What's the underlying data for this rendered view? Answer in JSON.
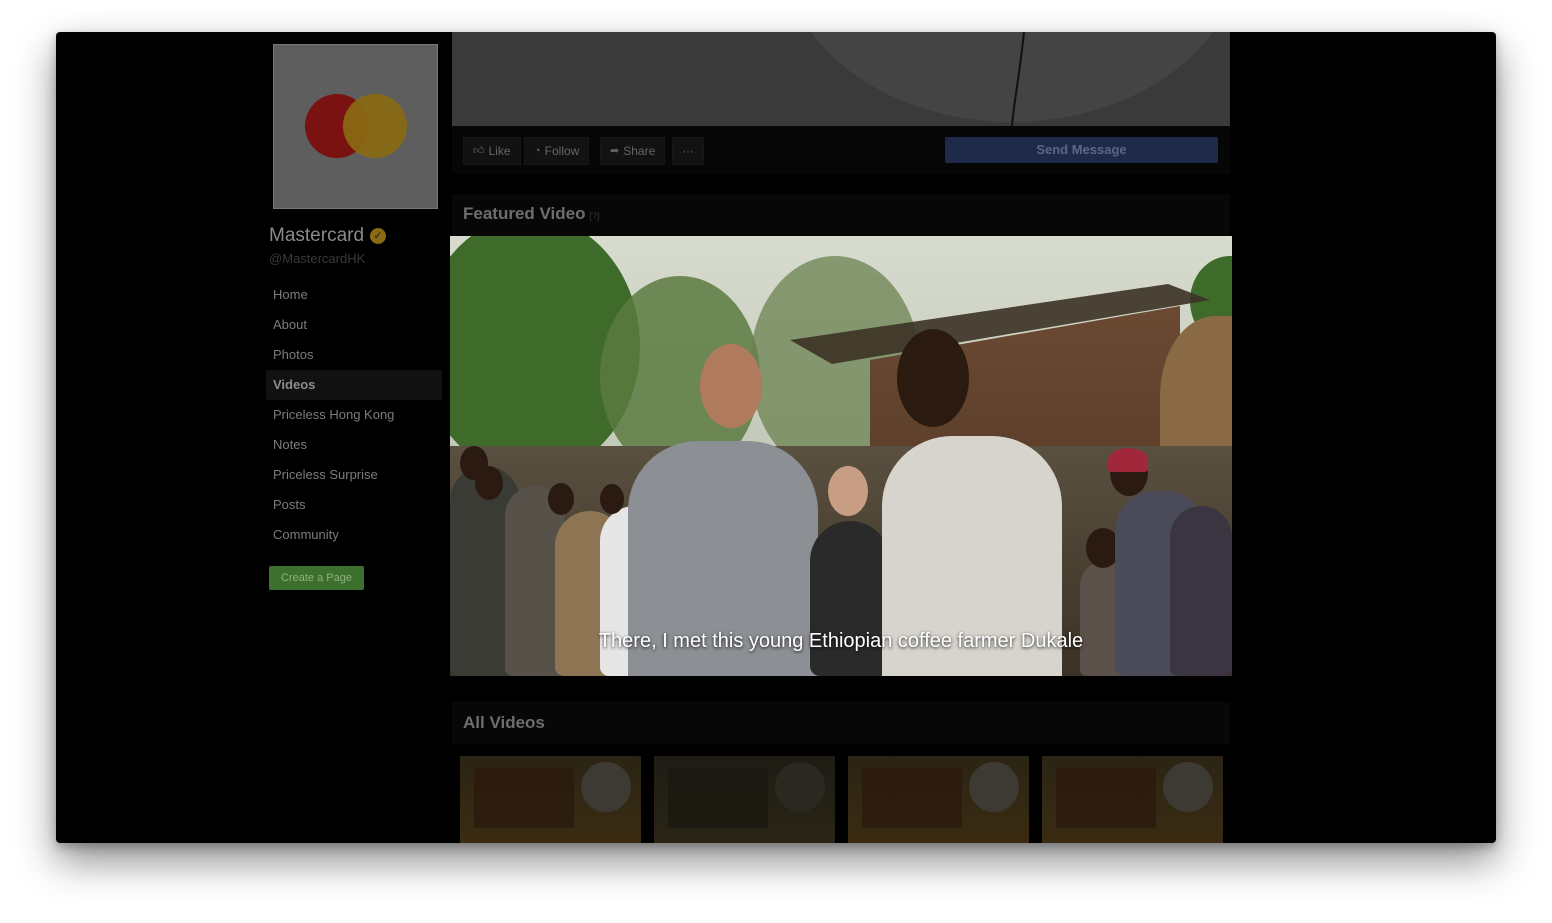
{
  "page": {
    "name": "Mastercard",
    "handle": "@MastercardHK",
    "verified_icon": "verified-badge-icon",
    "brand_colors": {
      "red": "#eb001b",
      "yellow": "#f79e1b"
    }
  },
  "nav": {
    "items": [
      {
        "label": "Home"
      },
      {
        "label": "About"
      },
      {
        "label": "Photos"
      },
      {
        "label": "Videos",
        "active": true
      },
      {
        "label": "Priceless Hong Kong"
      },
      {
        "label": "Notes"
      },
      {
        "label": "Priceless Surprise"
      },
      {
        "label": "Posts"
      },
      {
        "label": "Community"
      }
    ],
    "create_page": "Create a Page"
  },
  "actions": {
    "like": "Like",
    "follow": "Follow",
    "share": "Share",
    "more": "···",
    "send_message": "Send Message"
  },
  "featured": {
    "title": "Featured Video",
    "help": "[?]",
    "subtitle": "There, I met this young Ethiopian coffee farmer Dukale"
  },
  "all_videos": {
    "title": "All Videos"
  }
}
